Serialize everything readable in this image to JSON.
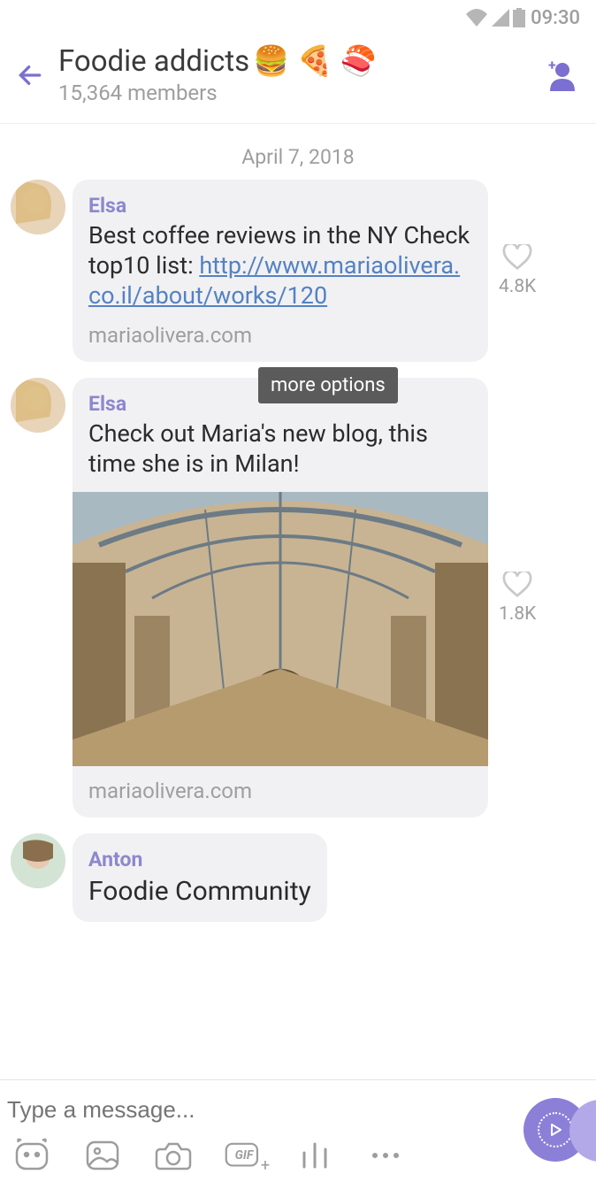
{
  "status": {
    "time": "09:30"
  },
  "header": {
    "title": "Foodie addicts",
    "emoji": "🍔 🍕 🍣",
    "subtitle": "15,364 members"
  },
  "date_separator": "April 7, 2018",
  "tooltip": "more options",
  "messages": [
    {
      "sender": "Elsa",
      "body_pre": "Best coffee reviews in the NY Check top10 list: ",
      "link": "http://www.mariaolivera.co.il/about/works/120",
      "domain": "mariaolivera.com",
      "likes": "4.8K"
    },
    {
      "sender": "Elsa",
      "body": "Check out Maria's new blog, this time she is in Milan!",
      "domain": "mariaolivera.com",
      "likes": "1.8K"
    },
    {
      "sender": "Anton",
      "body": "Foodie Community"
    }
  ],
  "compose": {
    "placeholder": "Type a message...",
    "gif_label": "GIF"
  }
}
